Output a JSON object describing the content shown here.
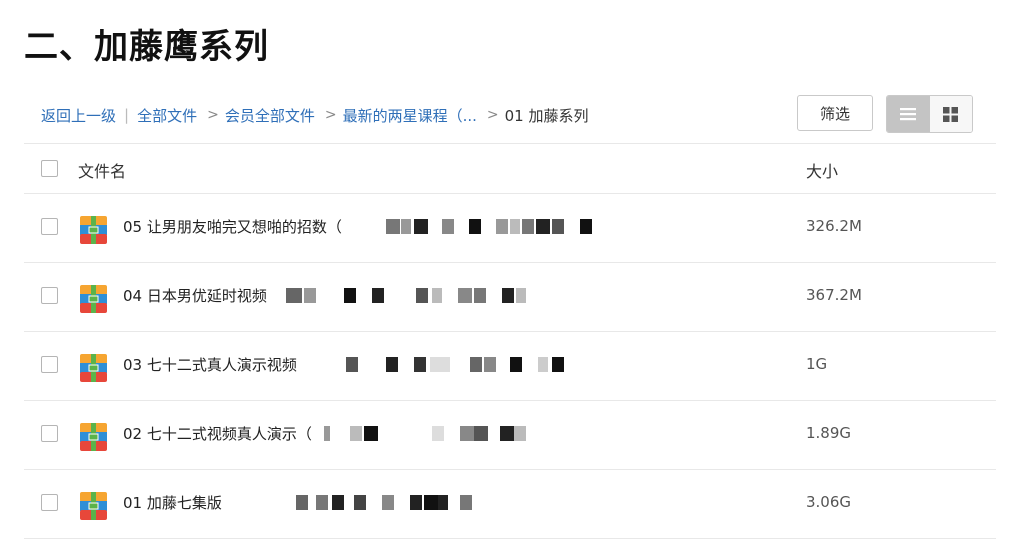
{
  "page": {
    "title": "二、加藤鹰系列"
  },
  "breadcrumb": {
    "back": "返回上一级",
    "separator": "|",
    "items": [
      "全部文件",
      "会员全部文件",
      "最新的两星课程（..."
    ],
    "arrow": ">",
    "current": "01 加藤系列"
  },
  "toolbar": {
    "filter_label": "筛选"
  },
  "view_mode": {
    "selected": "list"
  },
  "table": {
    "headers": {
      "name": "文件名",
      "size": "大小"
    },
    "rows": [
      {
        "name": "05 让男朋友啪完又想啪的招数（",
        "size": "326.2M",
        "icon": "archive-icon"
      },
      {
        "name": "04 日本男优延时视频",
        "size": "367.2M",
        "icon": "archive-icon"
      },
      {
        "name": "03 七十二式真人演示视频",
        "size": "1G",
        "icon": "archive-icon"
      },
      {
        "name": "02 七十二式视频真人演示（",
        "size": "1.89G",
        "icon": "archive-icon"
      },
      {
        "name": "01 加藤七集版",
        "size": "3.06G",
        "icon": "archive-icon"
      }
    ]
  },
  "colors": {
    "link": "#2f6fb8",
    "icon_top": "#f6a531",
    "icon_middle": "#2f8fd6",
    "icon_bottom": "#e7473a",
    "icon_band": "#5bb34a"
  }
}
